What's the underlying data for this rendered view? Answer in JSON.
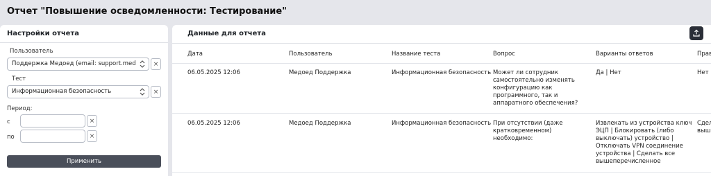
{
  "page": {
    "title": "Отчет \"Повышение осведомленности: Тестирование\""
  },
  "settings": {
    "title": "Настройки отчета",
    "user_label": "Пользователь",
    "user_value": "Поддержка Медоед (email: support.medoed@rtm",
    "test_label": "Тест",
    "test_value": "Информационная безопасность",
    "period_label": "Период:",
    "from_label": "с",
    "to_label": "по",
    "clear_symbol": "×",
    "apply_label": "Применить"
  },
  "data_panel": {
    "title": "Данные для отчета",
    "export_icon": "upload-icon",
    "columns": [
      "Дата",
      "Пользователь",
      "Название теста",
      "Вопрос",
      "Варианты ответов",
      "Прав"
    ],
    "rows": [
      {
        "date": "06.05.2025 12:06",
        "user": "Медоед Поддержка",
        "test": "Информационная безопасность",
        "question": [
          "Может ли сотрудник",
          "самостоятельно изменять",
          "конфигурацию как",
          "программного, так и",
          "аппаратного обеспечения?"
        ],
        "answers": [
          "Да | Нет"
        ],
        "correct": [
          "Нет"
        ]
      },
      {
        "date": "06.05.2025 12:06",
        "user": "Медоед Поддержка",
        "test": "Информационная безопасность",
        "question": [
          "При отсутствии (даже",
          "кратковременном) необходимо:"
        ],
        "answers": [
          "Извлекать из устройства ключ",
          "ЭЦП | Блокировать (либо",
          "выключать) устройство |",
          "Отключать VPN соединение",
          "устройства | Сделать все",
          "вышеперечисленное"
        ],
        "correct": [
          "Сдел",
          "выше"
        ]
      }
    ]
  },
  "colors": {
    "apply_bg": "#4a4f5a",
    "export_bg": "#2b2f38",
    "page_bg": "#e5e6eb"
  }
}
